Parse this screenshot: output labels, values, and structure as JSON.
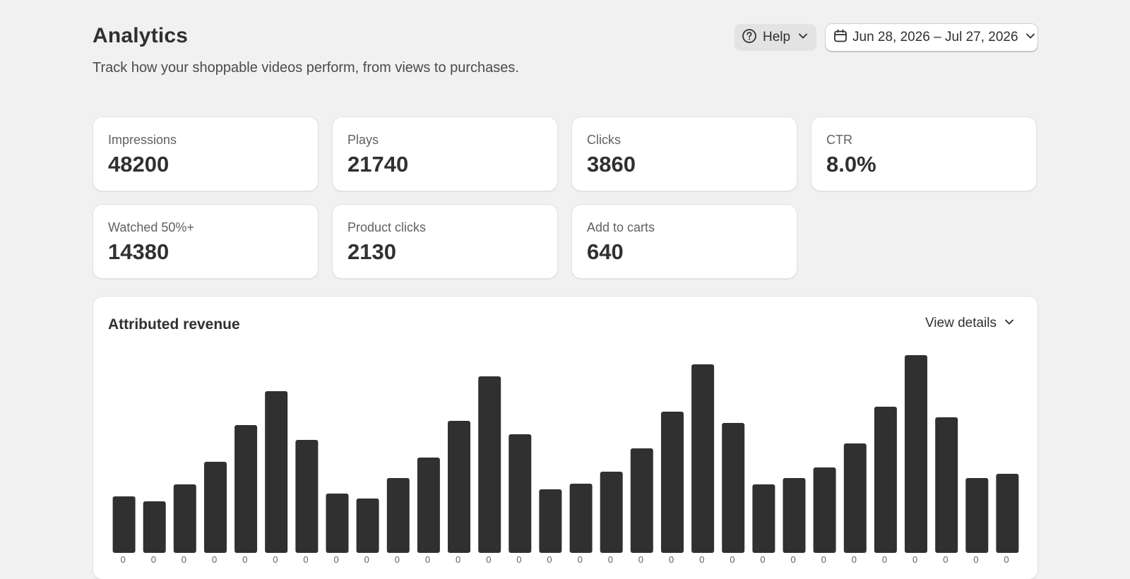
{
  "header": {
    "title": "Analytics",
    "subtitle": "Track how your shoppable videos perform, from views to purchases.",
    "help_label": "Help",
    "date_range_label": "Jun 28, 2026 – Jul 27, 2026"
  },
  "metrics": [
    {
      "label": "Impressions",
      "value": "48200"
    },
    {
      "label": "Plays",
      "value": "21740"
    },
    {
      "label": "Clicks",
      "value": "3860"
    },
    {
      "label": "CTR",
      "value": "8.0%"
    },
    {
      "label": "Watched 50%+",
      "value": "14380"
    },
    {
      "label": "Product clicks",
      "value": "2130"
    },
    {
      "label": "Add to carts",
      "value": "640"
    }
  ],
  "revenue": {
    "title": "Attributed revenue",
    "view_details_label": "View details"
  },
  "icons": {
    "help": "question-circle-icon",
    "calendar": "calendar-icon",
    "chevron": "chevron-down-icon"
  },
  "colors": {
    "background": "#f1f1f1",
    "card": "#ffffff",
    "bar": "#303030",
    "help_button": "#e3e3e3"
  },
  "chart_data": {
    "type": "bar",
    "title": "Attributed revenue",
    "xlabel": "",
    "ylabel": "",
    "tick_labels": [
      "0",
      "0",
      "0",
      "0",
      "0",
      "0",
      "0",
      "0",
      "0",
      "0",
      "0",
      "0",
      "0",
      "0",
      "0",
      "0",
      "0",
      "0",
      "0",
      "0",
      "0",
      "0",
      "0",
      "0",
      "0",
      "0",
      "0",
      "0",
      "0",
      "0"
    ],
    "values": [
      76,
      69,
      93,
      125,
      177,
      225,
      156,
      80,
      73,
      102,
      131,
      183,
      246,
      164,
      86,
      94,
      111,
      144,
      196,
      263,
      180,
      93,
      102,
      117,
      151,
      203,
      276,
      188,
      102,
      108
    ],
    "ylim": [
      0,
      276
    ],
    "grid": false,
    "legend": "none"
  }
}
